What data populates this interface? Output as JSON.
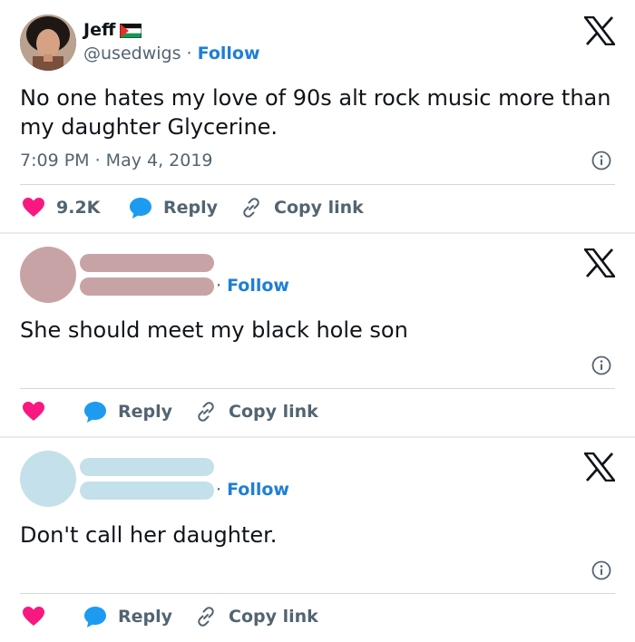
{
  "tweets": [
    {
      "name": "Jeff",
      "handle": "@usedwigs",
      "separator": "·",
      "follow_label": "Follow",
      "text": "No one hates my love of 90s alt rock music more than my daughter Glycerine.",
      "timestamp": "7:09 PM · May 4, 2019",
      "likes": "9.2K",
      "reply_label": "Reply",
      "copy_label": "Copy link",
      "avatar_color": "#3b2a22"
    },
    {
      "follow_line": "· Follow",
      "text": "She should meet my black hole son",
      "reply_label": "Reply",
      "copy_label": "Copy link",
      "avatar_color": "#c8a3a5"
    },
    {
      "follow_line": "· Follow",
      "text": "Don't call her daughter.",
      "reply_label": "Reply",
      "copy_label": "Copy link",
      "avatar_color": "#c4e0ea"
    }
  ],
  "colors": {
    "like": "#f91880",
    "reply": "#1d9bf0",
    "follow": "#1d7fd6",
    "secondary_text": "#536471"
  },
  "icons": [
    "x-logo-icon",
    "heart-icon",
    "reply-bubble-icon",
    "link-icon",
    "info-icon",
    "palestine-flag-icon"
  ]
}
